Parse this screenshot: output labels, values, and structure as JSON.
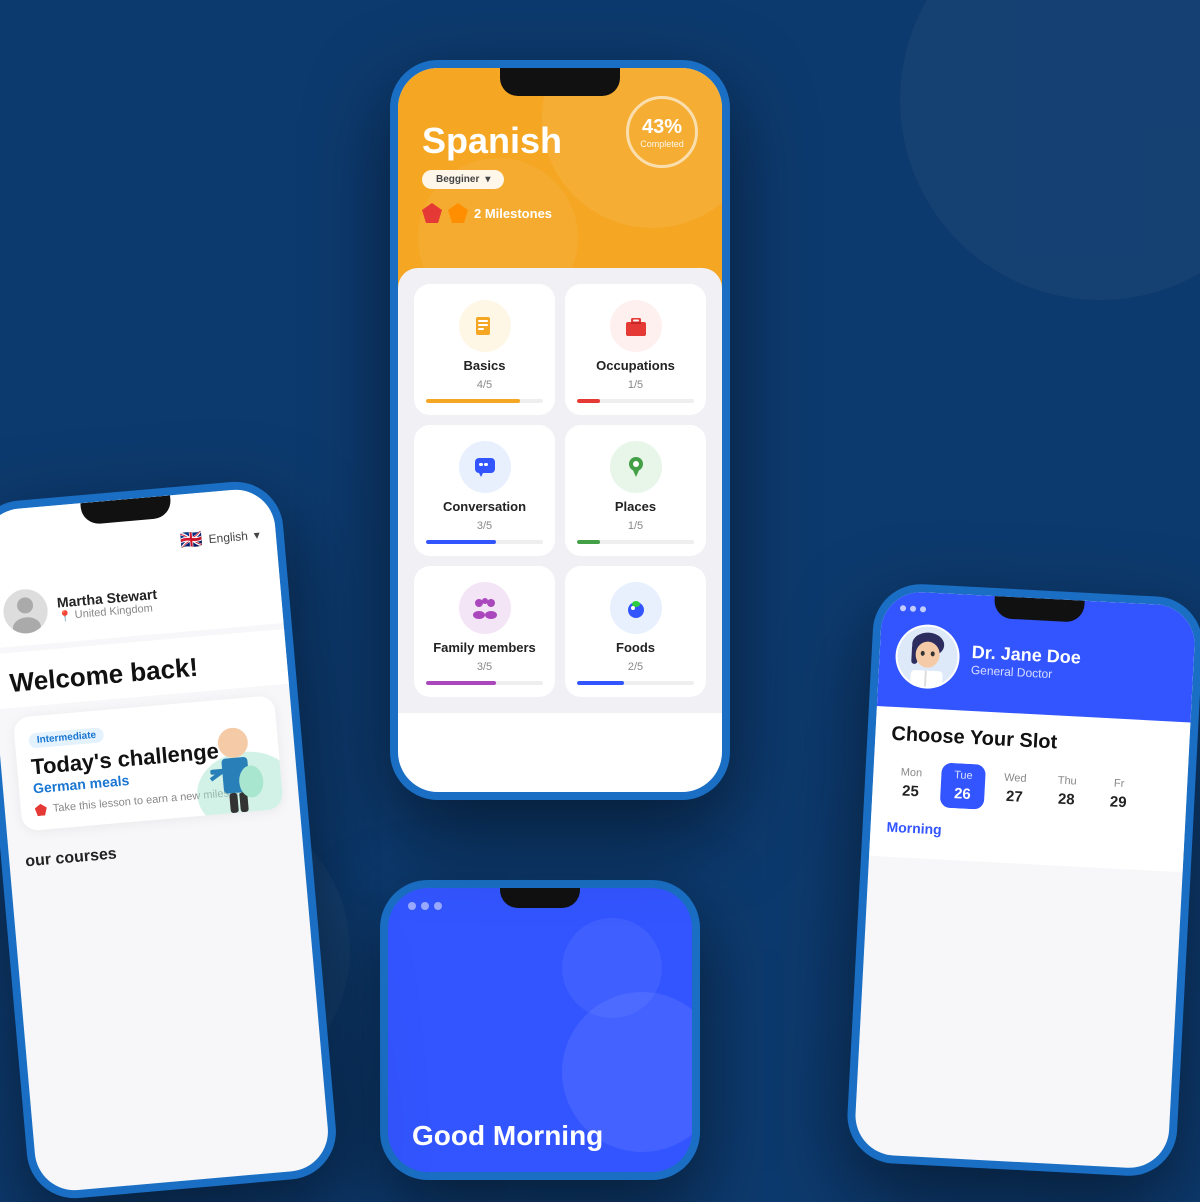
{
  "background": "#0d3a6e",
  "phone_center": {
    "header": {
      "title": "Spanish",
      "level": "Begginer",
      "progress_pct": "43%",
      "progress_label": "Completed",
      "milestones_text": "2 Milestones"
    },
    "categories": [
      {
        "name": "Basics",
        "count": "4/5",
        "icon": "📄",
        "icon_bg": "#fff7e6",
        "progress": 80,
        "bar_color": "#f5a623"
      },
      {
        "name": "Occupations",
        "count": "1/5",
        "icon": "💼",
        "icon_bg": "#fff0f0",
        "progress": 20,
        "bar_color": "#e53935"
      },
      {
        "name": "Conversation",
        "count": "3/5",
        "icon": "💬",
        "icon_bg": "#e8f0fe",
        "progress": 60,
        "bar_color": "#3355ff"
      },
      {
        "name": "Places",
        "count": "1/5",
        "icon": "📍",
        "icon_bg": "#e8f5e9",
        "progress": 20,
        "bar_color": "#43a047"
      },
      {
        "name": "Family members",
        "count": "3/5",
        "icon": "👨‍👩‍👧",
        "icon_bg": "#f3e5f5",
        "progress": 60,
        "bar_color": "#ab47bc"
      },
      {
        "name": "Foods",
        "count": "2/5",
        "icon": "🍎",
        "icon_bg": "#e8f0fe",
        "progress": 40,
        "bar_color": "#3355ff"
      }
    ]
  },
  "phone_left": {
    "language": "English",
    "user_name": "Martha Stewart",
    "user_location": "United Kingdom",
    "welcome": "Welcome back!",
    "badge": "Intermediate",
    "challenge_title": "Today's challenge",
    "challenge_link": "German meals",
    "challenge_desc": "Take this lesson to earn a new milestone",
    "courses_label": "our courses"
  },
  "phone_bottom": {
    "greeting": "Good Morning"
  },
  "phone_right": {
    "doctor_name": "Dr. Jane Doe",
    "doctor_title": "General Doctor",
    "slot_title": "Choose Your Slot",
    "days": [
      {
        "label": "Mon",
        "num": "25",
        "active": false
      },
      {
        "label": "Tue",
        "num": "26",
        "active": true
      },
      {
        "label": "Wed",
        "num": "27",
        "active": false
      },
      {
        "label": "Thu",
        "num": "28",
        "active": false
      },
      {
        "label": "Fr",
        "num": "29",
        "active": false
      }
    ],
    "time_label": "Morning"
  }
}
